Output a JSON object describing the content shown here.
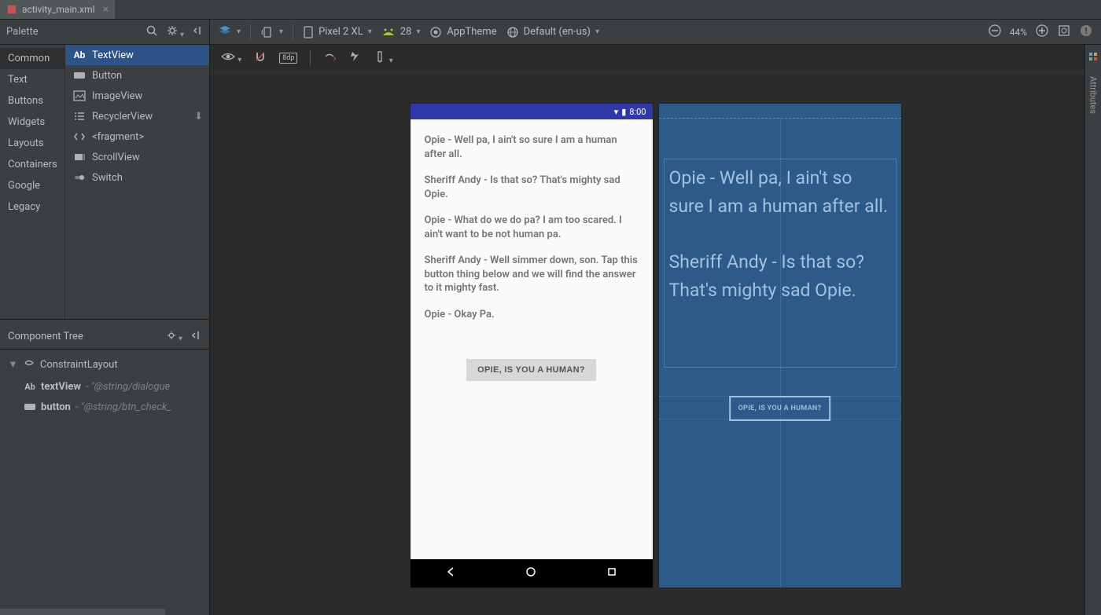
{
  "file_tab": {
    "name": "activity_main.xml"
  },
  "palette": {
    "title": "Palette",
    "categories": [
      "Common",
      "Text",
      "Buttons",
      "Widgets",
      "Layouts",
      "Containers",
      "Google",
      "Legacy"
    ],
    "selected_category": "Common",
    "components": [
      {
        "name": "TextView",
        "icon": "Ab",
        "selected": true
      },
      {
        "name": "Button",
        "icon": "button"
      },
      {
        "name": "ImageView",
        "icon": "image"
      },
      {
        "name": "RecyclerView",
        "icon": "list",
        "download": true
      },
      {
        "name": "<fragment>",
        "icon": "code"
      },
      {
        "name": "ScrollView",
        "icon": "scroll"
      },
      {
        "name": "Switch",
        "icon": "switch"
      }
    ]
  },
  "design_toolbar": {
    "device": "Pixel 2 XL",
    "api": "28",
    "theme": "AppTheme",
    "locale": "Default (en-us)",
    "zoom": "44%"
  },
  "component_tree": {
    "title": "Component Tree",
    "root": "ConstraintLayout",
    "children": [
      {
        "id": "textView",
        "value": "\"@string/dialogue",
        "icon": "Ab"
      },
      {
        "id": "button",
        "value": "\"@string/btn_check_",
        "icon": "button"
      }
    ]
  },
  "preview": {
    "status_time": "8:00",
    "dialogue": [
      "Opie - Well pa, I ain't so sure I am a human after all.",
      "Sheriff Andy - Is that so? That's mighty sad Opie.",
      "Opie - What do we do pa? I am too scared. I ain't want to be not human pa.",
      "Sheriff Andy - Well simmer down, son. Tap this button thing below and we will find the answer to it mighty fast.",
      "Opie - Okay Pa."
    ],
    "button_label": "OPIE, IS YOU A HUMAN?"
  },
  "blueprint": {
    "text": "Opie - Well pa, I ain't so sure I am a human after all.\n\nSheriff Andy - Is that so? That's mighty sad Opie.",
    "button_label": "OPIE, IS YOU A HUMAN?"
  },
  "attributes_panel": {
    "label": "Attributes"
  }
}
